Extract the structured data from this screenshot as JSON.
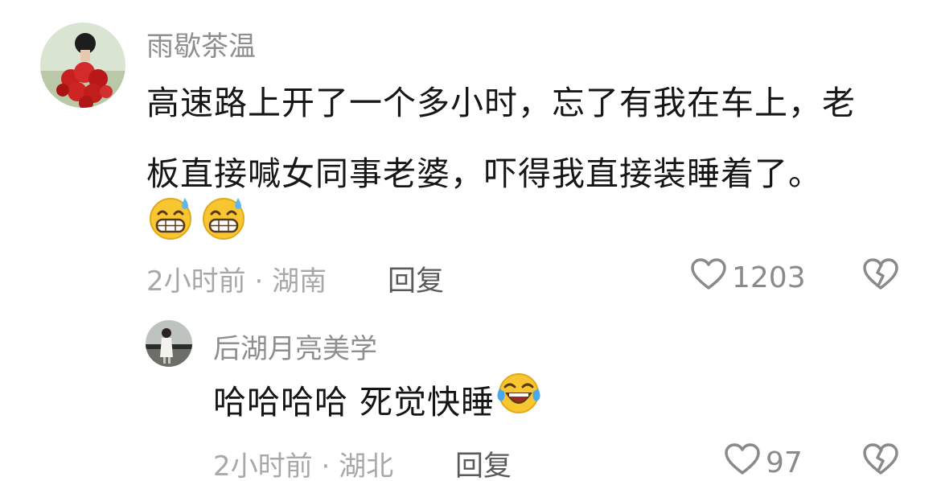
{
  "comment": {
    "username": "雨歇茶温",
    "text_line1": "高速路上开了一个多小时，忘了有我在车上，老",
    "text_line2": "板直接喊女同事老婆，吓得我直接装睡着了。",
    "emojis": [
      "grinning-sweat-emoji",
      "grinning-sweat-emoji"
    ],
    "time": "2小时前",
    "location": "湖南",
    "meta_separator": " · ",
    "reply_label": "回复",
    "like_count": "1203"
  },
  "reply": {
    "username": "后湖月亮美学",
    "text": "哈哈哈哈 死觉快睡",
    "emoji": "laughing-tears-emoji",
    "time": "2小时前",
    "location": "湖北",
    "meta_separator": " · ",
    "reply_label": "回复",
    "like_count": "97"
  },
  "icons": {
    "like": "heart-outline-icon",
    "dislike": "broken-heart-icon"
  },
  "colors": {
    "username": "#8e8e8e",
    "text": "#161616",
    "meta": "#a8a8a8",
    "icon": "#8a8a8a"
  }
}
